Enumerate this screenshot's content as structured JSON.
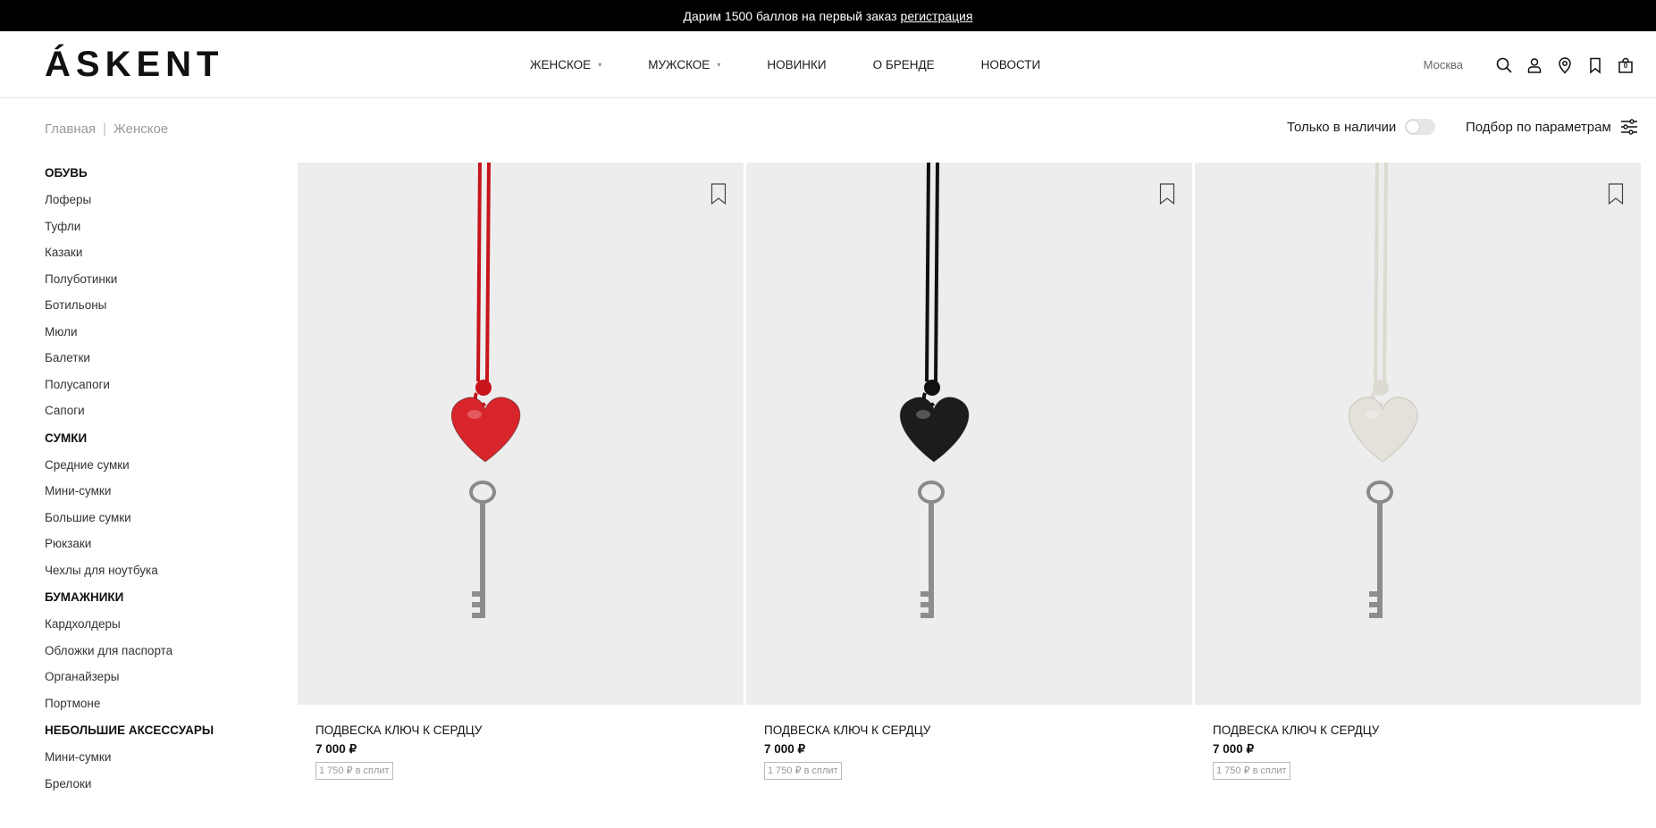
{
  "promo": {
    "text": "Дарим 1500 баллов на первый заказ",
    "link": "регистрация"
  },
  "header": {
    "logo": "ÁSKENT",
    "nav": [
      {
        "label": "ЖЕНСКОЕ",
        "dropdown": true
      },
      {
        "label": "МУЖСКОЕ",
        "dropdown": true
      },
      {
        "label": "НОВИНКИ",
        "dropdown": false
      },
      {
        "label": "О БРЕНДЕ",
        "dropdown": false
      },
      {
        "label": "НОВОСТИ",
        "dropdown": false
      }
    ],
    "city": "Москва",
    "cart_count": "0",
    "icons": [
      "search-icon",
      "user-icon",
      "location-pin-icon",
      "bookmark-icon",
      "cart-icon"
    ]
  },
  "breadcrumb": {
    "home": "Главная",
    "current": "Женское"
  },
  "filters": {
    "in_stock_label": "Только в наличии",
    "in_stock_on": false,
    "params_label": "Подбор по параметрам"
  },
  "sidebar": {
    "groups": [
      {
        "title": "ОБУВЬ",
        "items": [
          "Лоферы",
          "Туфли",
          "Казаки",
          "Полуботинки",
          "Ботильоны",
          "Мюли",
          "Балетки",
          "Полусапоги",
          "Сапоги"
        ]
      },
      {
        "title": "СУМКИ",
        "items": [
          "Средние сумки",
          "Мини-сумки",
          "Большие сумки",
          "Рюкзаки",
          "Чехлы для ноутбука"
        ]
      },
      {
        "title": "БУМАЖНИКИ",
        "items": [
          "Кардхолдеры",
          "Обложки для паспорта",
          "Органайзеры",
          "Портмоне"
        ]
      },
      {
        "title": "НЕБОЛЬШИЕ АКСЕССУАРЫ",
        "items": [
          "Мини-сумки",
          "Брелоки"
        ]
      }
    ]
  },
  "products": [
    {
      "title": "ПОДВЕСКА КЛЮЧ К СЕРДЦУ",
      "price": "7 000 ₽",
      "split": "1 750 ₽ в сплит",
      "color": "#d8252b",
      "cord": "#c8141c"
    },
    {
      "title": "ПОДВЕСКА КЛЮЧ К СЕРДЦУ",
      "price": "7 000 ₽",
      "split": "1 750 ₽ в сплит",
      "color": "#1c1c1c",
      "cord": "#111111"
    },
    {
      "title": "ПОДВЕСКА КЛЮЧ К СЕРДЦУ",
      "price": "7 000 ₽",
      "split": "1 750 ₽ в сплит",
      "color": "#e3e1da",
      "cord": "#dddad2"
    }
  ]
}
